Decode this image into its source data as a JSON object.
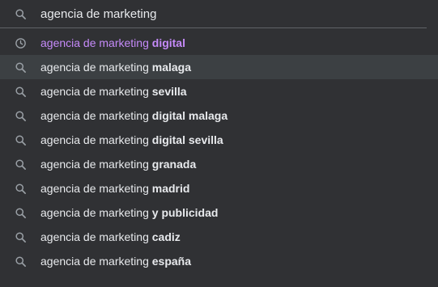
{
  "search": {
    "query": "agencia de marketing",
    "icon": "search-icon"
  },
  "colors": {
    "background": "#303134",
    "selected": "#3c4043",
    "text": "#e8eaed",
    "visited": "#c58af9",
    "icon": "#9aa0a6"
  },
  "suggestions": [
    {
      "prefix": "agencia de marketing ",
      "completion": "digital",
      "icon": "history-icon",
      "visited": true,
      "selected": false
    },
    {
      "prefix": "agencia de marketing ",
      "completion": "malaga",
      "icon": "search-icon",
      "visited": false,
      "selected": true
    },
    {
      "prefix": "agencia de marketing ",
      "completion": "sevilla",
      "icon": "search-icon",
      "visited": false,
      "selected": false
    },
    {
      "prefix": "agencia de marketing ",
      "completion": "digital malaga",
      "icon": "search-icon",
      "visited": false,
      "selected": false
    },
    {
      "prefix": "agencia de marketing ",
      "completion": "digital sevilla",
      "icon": "search-icon",
      "visited": false,
      "selected": false
    },
    {
      "prefix": "agencia de marketing ",
      "completion": "granada",
      "icon": "search-icon",
      "visited": false,
      "selected": false
    },
    {
      "prefix": "agencia de marketing ",
      "completion": "madrid",
      "icon": "search-icon",
      "visited": false,
      "selected": false
    },
    {
      "prefix": "agencia de marketing ",
      "completion": "y publicidad",
      "icon": "search-icon",
      "visited": false,
      "selected": false
    },
    {
      "prefix": "agencia de marketing ",
      "completion": "cadiz",
      "icon": "search-icon",
      "visited": false,
      "selected": false
    },
    {
      "prefix": "agencia de marketing ",
      "completion": "españa",
      "icon": "search-icon",
      "visited": false,
      "selected": false
    }
  ]
}
